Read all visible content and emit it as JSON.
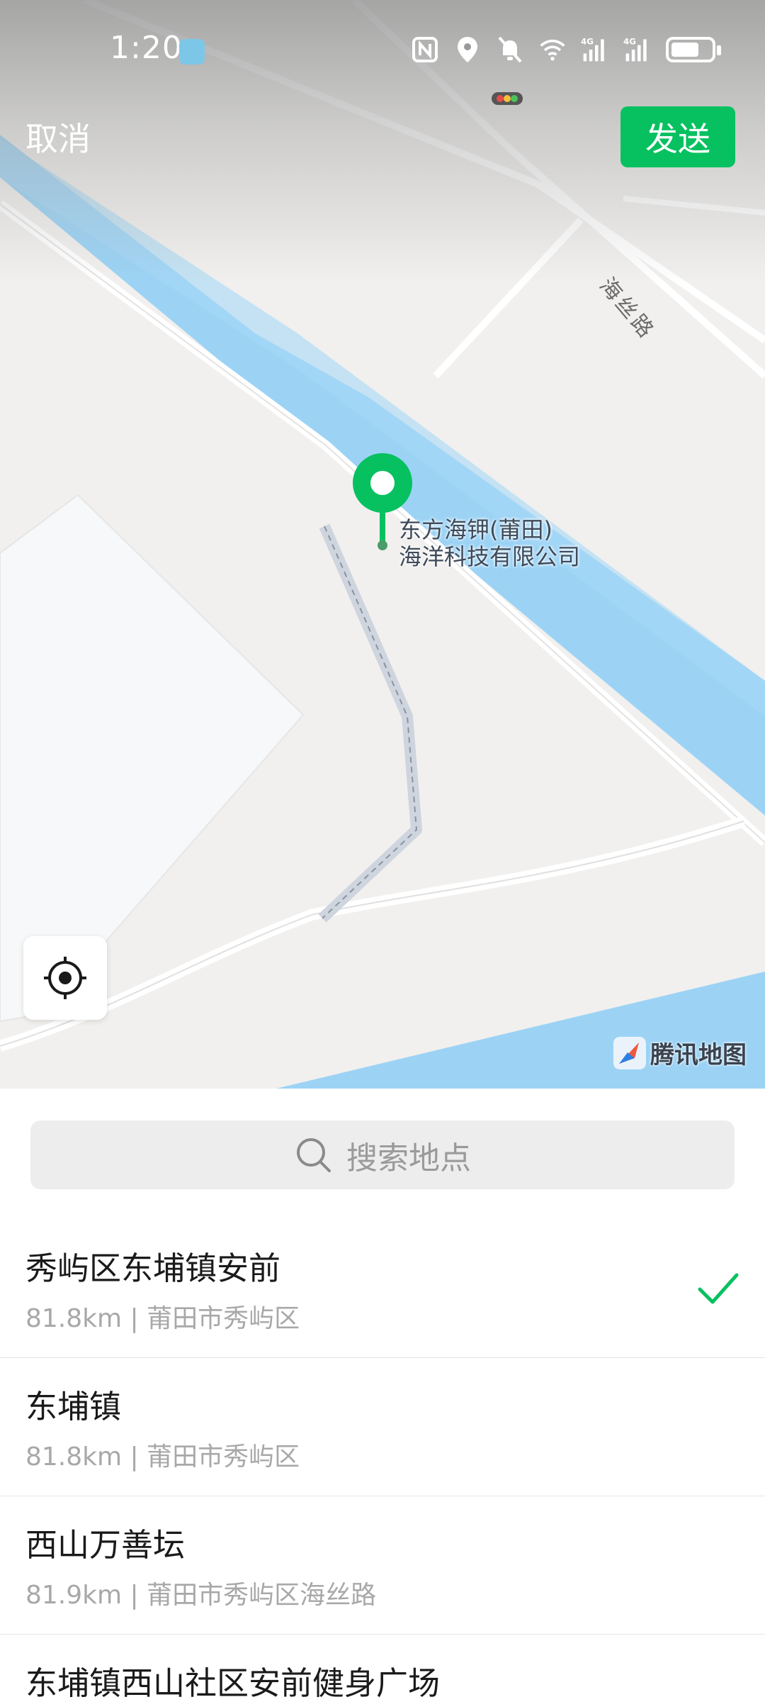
{
  "status_bar": {
    "time": "1:20",
    "battery_level": 0.7
  },
  "header": {
    "cancel_label": "取消",
    "send_label": "发送"
  },
  "map": {
    "poi_name_line1": "东方海钾(莆田)",
    "poi_name_line2": "海洋科技有限公司",
    "road_name": "海丝路",
    "provider_label": "腾讯地图",
    "colors": {
      "land": "#f1f0ee",
      "water": "#9cd3f5",
      "road": "#ffffff",
      "pin": "#07c160"
    }
  },
  "search": {
    "placeholder": "搜索地点"
  },
  "results": [
    {
      "title": "秀屿区东埔镇安前",
      "distance": "81.8km",
      "address": "莆田市秀屿区",
      "selected": true
    },
    {
      "title": "东埔镇",
      "distance": "81.8km",
      "address": "莆田市秀屿区",
      "selected": false
    },
    {
      "title": "西山万善坛",
      "distance": "81.9km",
      "address": "莆田市秀屿区海丝路",
      "selected": false
    },
    {
      "title": "东埔镇西山社区安前健身广场",
      "distance": "",
      "address": "",
      "selected": false
    }
  ],
  "accent_color": "#07c160"
}
